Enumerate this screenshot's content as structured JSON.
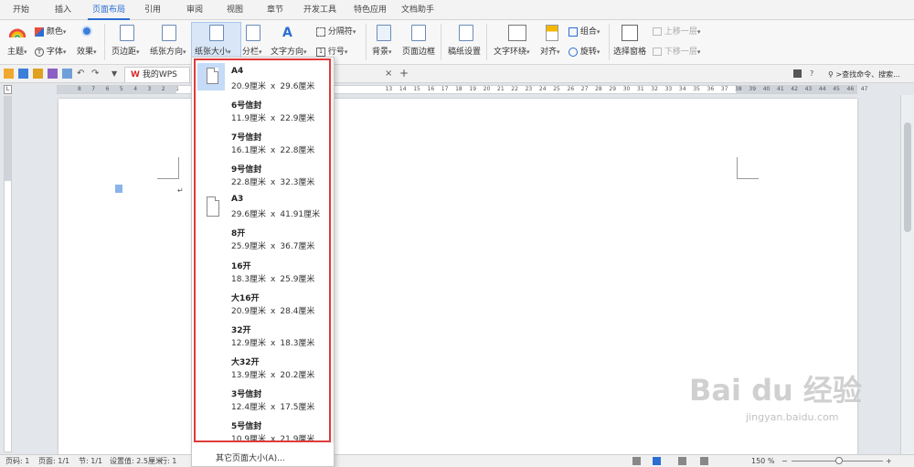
{
  "menu": {
    "tabs": [
      {
        "label": "开始"
      },
      {
        "label": "插入"
      },
      {
        "label": "页面布局"
      },
      {
        "label": "引用"
      },
      {
        "label": "审阅"
      },
      {
        "label": "视图"
      },
      {
        "label": "章节"
      },
      {
        "label": "开发工具"
      },
      {
        "label": "特色应用"
      },
      {
        "label": "文档助手"
      }
    ],
    "active": "页面布局"
  },
  "ribbon": {
    "color_label": "颜色",
    "theme_label": "主题",
    "font_label": "字体",
    "effect_label": "效果",
    "margin_label": "页边距",
    "orientation_label": "纸张方向",
    "size_label": "纸张大小",
    "columns_label": "分栏",
    "text_direction_label": "文字方向",
    "breaks_label": "分隔符",
    "line_numbers_label": "行号",
    "background_label": "背景",
    "page_border_label": "页面边框",
    "manuscript_label": "稿纸设置",
    "wrap_label": "文字环绕",
    "align_label": "对齐",
    "group_label": "组合",
    "rotate_label": "旋转",
    "selection_pane_label": "选择窗格",
    "bring_forward_label": "上移一层",
    "send_backward_label": "下移一层"
  },
  "quickbar": {
    "tab_label": "我的WPS",
    "search_label": ">查找命令、搜索..."
  },
  "ruler": {
    "numbers": [
      "8",
      "7",
      "6",
      "5",
      "4",
      "3",
      "2",
      "1",
      "",
      "1",
      "2",
      "",
      "",
      "",
      "",
      "",
      "",
      "",
      "",
      "",
      "",
      "",
      "13",
      "14",
      "15",
      "16",
      "17",
      "18",
      "19",
      "20",
      "21",
      "22",
      "23",
      "24",
      "25",
      "26",
      "27",
      "28",
      "29",
      "30",
      "31",
      "32",
      "33",
      "34",
      "35",
      "36",
      "37",
      "38",
      "39",
      "40",
      "41",
      "42",
      "43",
      "44",
      "45",
      "46",
      "47"
    ]
  },
  "dropdown": {
    "options": [
      {
        "name": "A4",
        "width": "20.9厘米",
        "height": "29.6厘米"
      },
      {
        "name": "6号信封",
        "width": "11.9厘米",
        "height": "22.9厘米"
      },
      {
        "name": "7号信封",
        "width": "16.1厘米",
        "height": "22.8厘米"
      },
      {
        "name": "9号信封",
        "width": "22.8厘米",
        "height": "32.3厘米"
      },
      {
        "name": "A3",
        "width": "29.6厘米",
        "height": "41.91厘米"
      },
      {
        "name": "8开",
        "width": "25.9厘米",
        "height": "36.7厘米"
      },
      {
        "name": "16开",
        "width": "18.3厘米",
        "height": "25.9厘米"
      },
      {
        "name": "大16开",
        "width": "20.9厘米",
        "height": "28.4厘米"
      },
      {
        "name": "32开",
        "width": "12.9厘米",
        "height": "18.3厘米"
      },
      {
        "name": "大32开",
        "width": "13.9厘米",
        "height": "20.2厘米"
      },
      {
        "name": "3号信封",
        "width": "12.4厘米",
        "height": "17.5厘米"
      },
      {
        "name": "5号信封",
        "width": "10.9厘米",
        "height": "21.9厘米"
      }
    ],
    "separator": "x",
    "more_label": "其它页面大小(A)..."
  },
  "status": {
    "page_code": "页码: 1",
    "page": "页面: 1/1",
    "section": "节: 1/1",
    "setting": "设置值: 2.5厘米",
    "row": "行: 1",
    "zoom": "150 %"
  },
  "watermark": {
    "main": "Bai du 经验",
    "sub": "jingyan.baidu.com"
  },
  "colors": {
    "accent": "#2a6ed2",
    "highlight_frame": "#e03a3a",
    "selected_bg": "#c5dbf7"
  }
}
